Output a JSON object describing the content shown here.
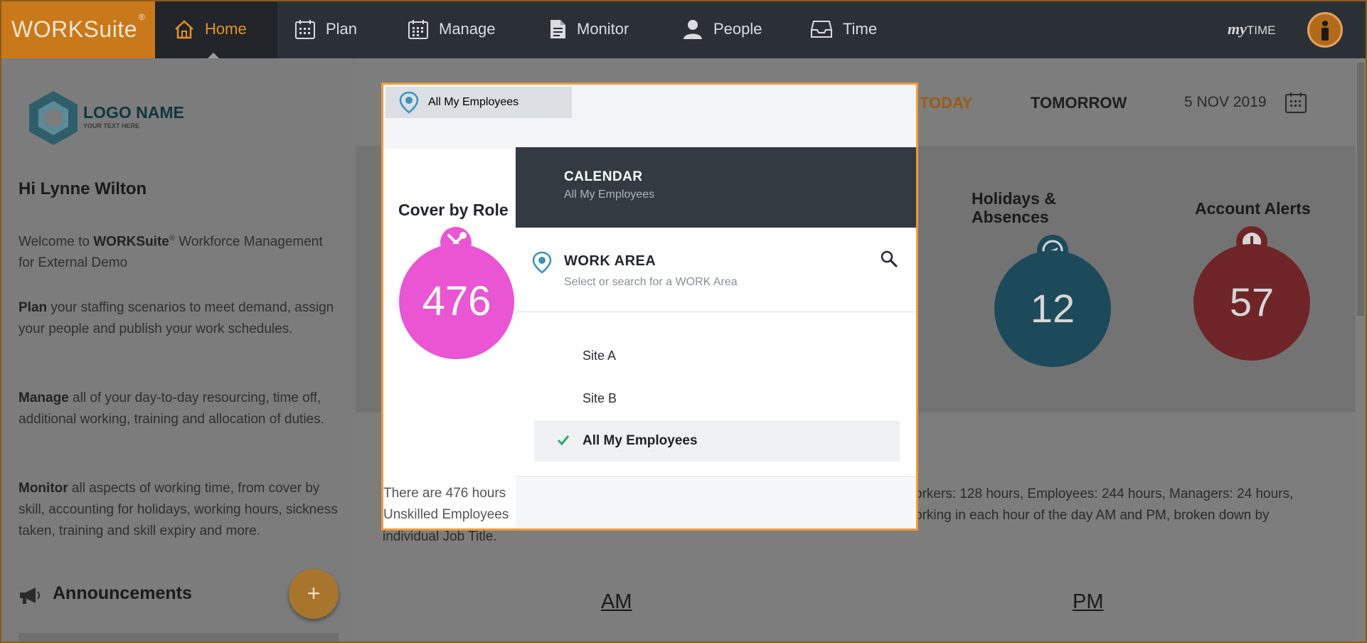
{
  "nav": {
    "brand": "WORKSuite",
    "brand_mark": "®",
    "items": [
      {
        "label": "Home",
        "icon": "home-icon",
        "active": true
      },
      {
        "label": "Plan",
        "icon": "calendar-icon"
      },
      {
        "label": "Manage",
        "icon": "calendar-grid-icon"
      },
      {
        "label": "Monitor",
        "icon": "document-icon"
      },
      {
        "label": "People",
        "icon": "person-icon"
      },
      {
        "label": "Time",
        "icon": "inbox-icon"
      }
    ],
    "mytime_my": "my",
    "mytime_time": "TIME",
    "accent_color": "#e39322"
  },
  "sidebar": {
    "logo_name": "LOGO NAME",
    "logo_sub": "YOUR TEXT HERE",
    "greeting": "Hi Lynne Wilton",
    "welcome_prefix": "Welcome to ",
    "welcome_brand": "WORKSuite",
    "welcome_mark": "®",
    "welcome_suffix": " Workforce Management for External Demo",
    "plan_bold": "Plan",
    "plan_text": " your staffing scenarios to meet demand, assign your people and publish your work schedules.",
    "manage_bold": "Manage",
    "manage_text": " all of your day-to-day resourcing, time off, additional working, training and allocation of duties.",
    "monitor_bold": "Monitor",
    "monitor_text": " all aspects of working time, from cover by skill, accounting for holidays, working hours, sickness taken, training and skill expiry and more.",
    "announcements": "Announcements",
    "add_label": "+"
  },
  "dates": {
    "today": "TODAY",
    "tomorrow": "TOMORROW",
    "selected": "5 NOV 2019"
  },
  "kpis": {
    "holidays_title_1": "Holidays &",
    "holidays_title_2": "Absences",
    "holidays_value": "12",
    "holidays_color": "#1d4a5b",
    "alerts_title": "Account Alerts",
    "alerts_value": "57",
    "alerts_color": "#6f2427"
  },
  "description": {
    "right_line1": "orkers: 128 hours, Employees: 244 hours, Managers: 24 hours,",
    "right_line2": "orking in each hour of the day AM and PM, broken down by",
    "bottom_line": "individual Job Title."
  },
  "ampm": {
    "am": "AM",
    "pm": "PM"
  },
  "modal": {
    "selected_area": "All My Employees",
    "cover_title": "Cover by Role",
    "cover_value": "476",
    "cover_color": "#e955d2",
    "text_line1": "There are 476 hours",
    "text_line2": "Unskilled Employees",
    "panel": {
      "title": "CALENDAR",
      "subtitle": "All My Employees",
      "work_area_title": "WORK AREA",
      "work_area_hint": "Select or search for a WORK Area",
      "options": [
        {
          "label": "Site A",
          "selected": false
        },
        {
          "label": "Site B",
          "selected": false
        },
        {
          "label": "All My Employees",
          "selected": true
        }
      ]
    }
  }
}
